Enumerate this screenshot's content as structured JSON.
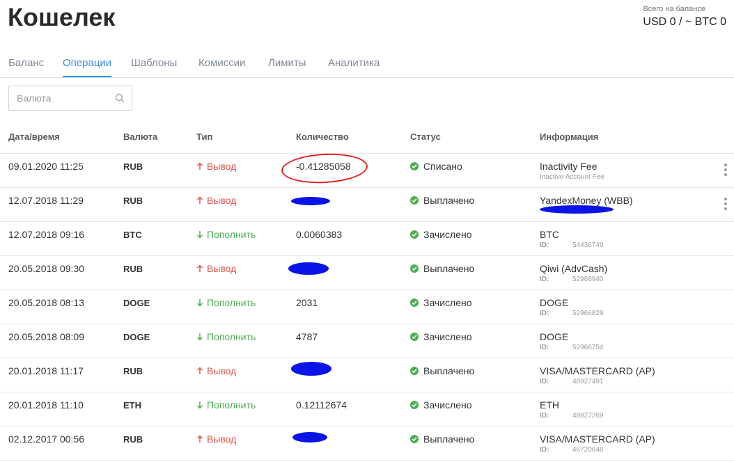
{
  "header": {
    "title": "Кошелек",
    "balance_label": "Всего на балансе",
    "balance_value": "USD 0 / ~ BTC 0"
  },
  "tabs": [
    {
      "label": "Баланс",
      "active": false
    },
    {
      "label": "Операции",
      "active": true
    },
    {
      "label": "Шаблоны",
      "active": false
    },
    {
      "label": "Комиссии",
      "active": false
    },
    {
      "label": "Лимиты",
      "active": false
    },
    {
      "label": "Аналитика",
      "active": false
    }
  ],
  "search": {
    "placeholder": "Валюта",
    "value": ""
  },
  "table": {
    "columns": [
      "Дата/время",
      "Валюта",
      "Тип",
      "Количество",
      "Статус",
      "Информация"
    ],
    "id_label": "ID:",
    "rows": [
      {
        "date": "09.01.2020 11:25",
        "currency": "RUB",
        "type": "Вывод",
        "direction": "out",
        "amount": "-0.41285058",
        "status": "Списано",
        "info_title": "Inactivity Fee",
        "info_sub": "Inactive Account Fee",
        "info_id": ""
      },
      {
        "date": "12.07.2018 11:29",
        "currency": "RUB",
        "type": "Вывод",
        "direction": "out",
        "amount": "",
        "status": "Выплачено",
        "info_title": "YandexMoney (WBB)",
        "info_sub": "",
        "info_id": ""
      },
      {
        "date": "12.07.2018 09:16",
        "currency": "BTC",
        "type": "Пополнить",
        "direction": "in",
        "amount": "0.0060383",
        "status": "Зачислено",
        "info_title": "BTC",
        "info_sub": "",
        "info_id": "54436749"
      },
      {
        "date": "20.05.2018 09:30",
        "currency": "RUB",
        "type": "Вывод",
        "direction": "out",
        "amount": "",
        "status": "Выплачено",
        "info_title": "Qiwi (AdvCash)",
        "info_sub": "",
        "info_id": "52968940"
      },
      {
        "date": "20.05.2018 08:13",
        "currency": "DOGE",
        "type": "Пополнить",
        "direction": "in",
        "amount": "2031",
        "status": "Зачислено",
        "info_title": "DOGE",
        "info_sub": "",
        "info_id": "52966829"
      },
      {
        "date": "20.05.2018 08:09",
        "currency": "DOGE",
        "type": "Пополнить",
        "direction": "in",
        "amount": "4787",
        "status": "Зачислено",
        "info_title": "DOGE",
        "info_sub": "",
        "info_id": "52966754"
      },
      {
        "date": "20.01.2018 11:17",
        "currency": "RUB",
        "type": "Вывод",
        "direction": "out",
        "amount": "",
        "status": "Выплачено",
        "info_title": "VISA/MASTERCARD (AP)",
        "info_sub": "",
        "info_id": "48927491"
      },
      {
        "date": "20.01.2018 11:10",
        "currency": "ETH",
        "type": "Пополнить",
        "direction": "in",
        "amount": "0.12112674",
        "status": "Зачислено",
        "info_title": "ETH",
        "info_sub": "",
        "info_id": "48927269"
      },
      {
        "date": "02.12.2017 00:56",
        "currency": "RUB",
        "type": "Вывод",
        "direction": "out",
        "amount": "",
        "status": "Выплачено",
        "info_title": "VISA/MASTERCARD (AP)",
        "info_sub": "",
        "info_id": "46720648"
      }
    ]
  },
  "colors": {
    "accent": "#3d8fd6",
    "withdraw": "#e5534b",
    "deposit": "#4caf50",
    "status_ok": "#4caf50",
    "redaction": "#0a14e6",
    "annotation": "#e02020"
  },
  "icons": {
    "search": "search-icon",
    "withdraw": "arrow-up-icon",
    "deposit": "arrow-down-icon",
    "status": "check-circle-icon",
    "more": "more-vertical-icon"
  }
}
